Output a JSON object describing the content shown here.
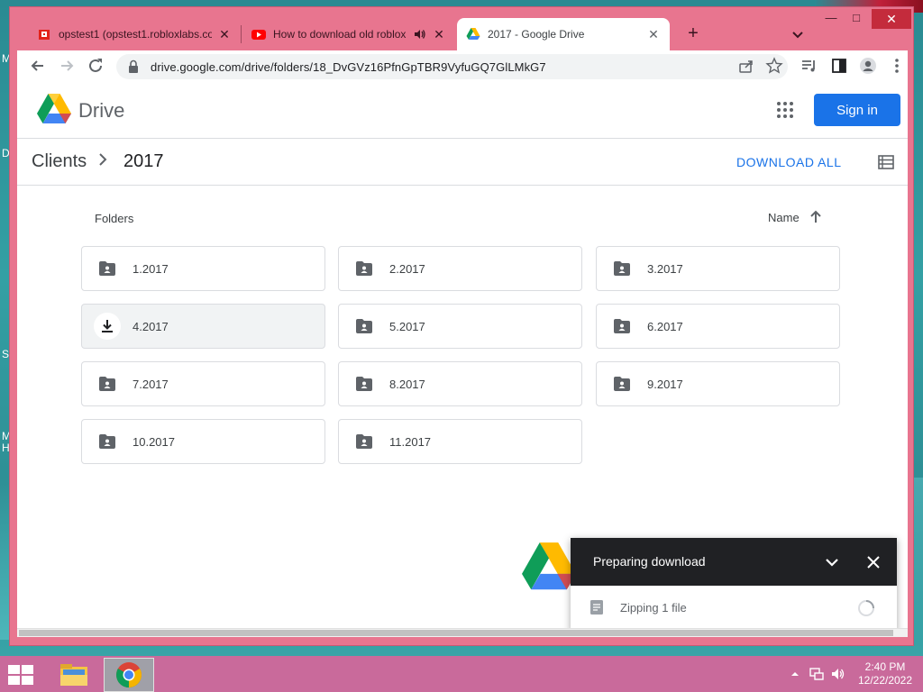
{
  "desktop": {
    "edge_letters": [
      "M",
      "D",
      "S",
      "M",
      "H"
    ]
  },
  "browser": {
    "tabs": [
      {
        "title": "opstest1 (opstest1.robloxlabs.co",
        "favicon": "roblox-favicon",
        "active": false
      },
      {
        "title": "How to download old roblox",
        "favicon": "youtube-favicon",
        "active": false,
        "audio": true
      },
      {
        "title": "2017 - Google Drive",
        "favicon": "google-drive-favicon",
        "active": true
      }
    ],
    "url": "drive.google.com/drive/folders/18_DvGVz16PfnGpTBR9VyfuGQ7GlLMkG7",
    "window_controls": {
      "minimize": "—",
      "maximize": "□",
      "close": "✕"
    }
  },
  "drive": {
    "product_name": "Drive",
    "signin_label": "Sign in",
    "breadcrumb": {
      "parent": "Clients",
      "current": "2017"
    },
    "download_all_label": "DOWNLOAD ALL",
    "section_label": "Folders",
    "sort_label": "Name",
    "folders": [
      {
        "name": "1.2017"
      },
      {
        "name": "2.2017"
      },
      {
        "name": "3.2017"
      },
      {
        "name": "4.2017",
        "state": "downloading"
      },
      {
        "name": "5.2017"
      },
      {
        "name": "6.2017"
      },
      {
        "name": "7.2017"
      },
      {
        "name": "8.2017"
      },
      {
        "name": "9.2017"
      },
      {
        "name": "10.2017"
      },
      {
        "name": "11.2017"
      }
    ],
    "download_panel": {
      "title": "Preparing download",
      "status": "Zipping 1 file"
    }
  },
  "taskbar": {
    "time": "2:40 PM",
    "date": "12/22/2022"
  },
  "colors": {
    "accent": "#1a73e8",
    "frame": "#e8758f",
    "taskbar": "#c96a9b"
  }
}
